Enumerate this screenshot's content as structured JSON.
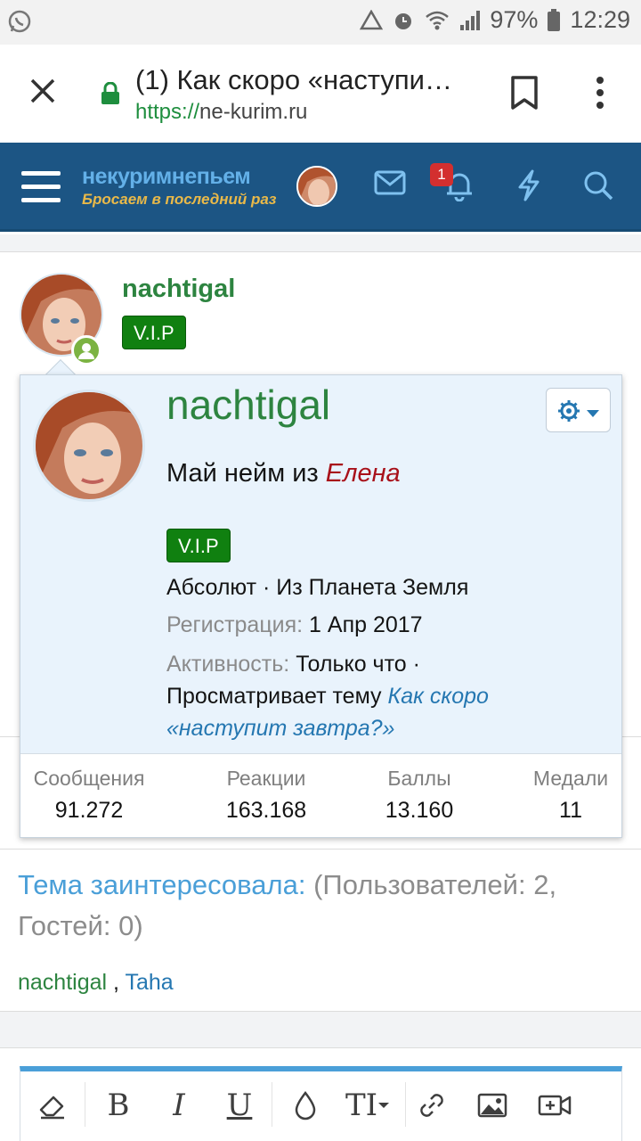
{
  "status_bar": {
    "battery": "97%",
    "time": "12:29"
  },
  "browser": {
    "tab_title": "(1) Как скоро «наступи…",
    "url_scheme": "https://",
    "url_host": "ne-kurim.ru"
  },
  "site": {
    "logo_line1": "некуримнепьем",
    "logo_line2": "Бросаем в последний раз",
    "alerts_badge": "1"
  },
  "post": {
    "username": "nachtigal",
    "badge": "V.I.P"
  },
  "card": {
    "username": "nachtigal",
    "title_prefix": "Май нейм из",
    "title_name": "Елена",
    "badge": "V.I.P",
    "rank_location": "Абсолют · Из Планета Земля",
    "reg_label": "Регистрация:",
    "reg_value": "1 Апр 2017",
    "activity_label": "Активность:",
    "activity_value": "Только что ·",
    "viewing_prefix": "Просматривает тему",
    "viewing_link_1": "Как скоро",
    "viewing_link_2": "«наступит завтра?»",
    "stats": [
      {
        "label": "Сообщения",
        "value": "91.272"
      },
      {
        "label": "Реакции",
        "value": "163.168"
      },
      {
        "label": "Баллы",
        "value": "13.160"
      },
      {
        "label": "Медали",
        "value": "11"
      }
    ]
  },
  "viewers": {
    "title": "Тема заинтересовала:",
    "counts": "(Пользователей: 2, Гостей: 0)",
    "user1": "nachtigal",
    "separator": ",",
    "user2": "Taha"
  },
  "editor": {
    "tools": [
      "eraser-icon",
      "bold",
      "italic",
      "underline",
      "color-drop-icon",
      "text-size",
      "link-icon",
      "image-icon",
      "video-icon"
    ],
    "bold": "B",
    "italic": "I",
    "underline": "U",
    "text_size": "TI"
  },
  "colors": {
    "header_bg": "#1c5584",
    "username_green": "#2d8440",
    "vip_green": "#108010",
    "link_blue": "#2577b1",
    "card_bg": "#e9f3fc",
    "name_red": "#a8111a"
  }
}
